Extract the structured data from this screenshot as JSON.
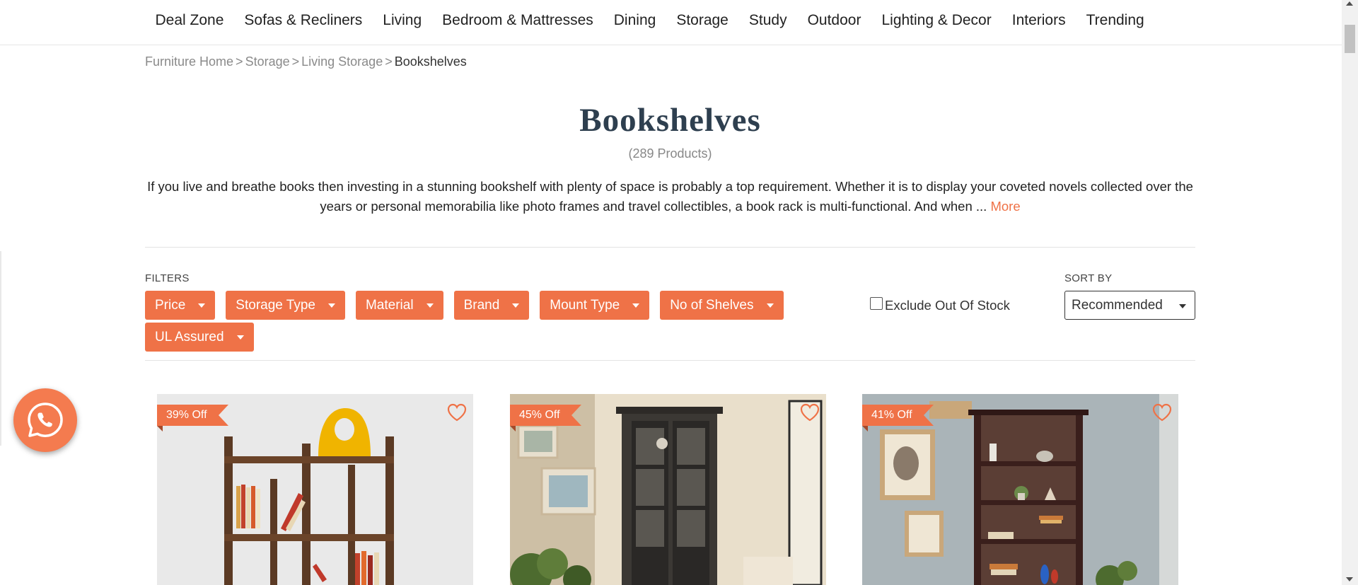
{
  "nav": {
    "items": [
      {
        "label": "Deal Zone"
      },
      {
        "label": "Sofas & Recliners"
      },
      {
        "label": "Living"
      },
      {
        "label": "Bedroom & Mattresses"
      },
      {
        "label": "Dining"
      },
      {
        "label": "Storage"
      },
      {
        "label": "Study"
      },
      {
        "label": "Outdoor"
      },
      {
        "label": "Lighting & Decor"
      },
      {
        "label": "Interiors"
      },
      {
        "label": "Trending"
      }
    ]
  },
  "breadcrumb": {
    "items": [
      "Furniture Home",
      "Storage",
      "Living Storage"
    ],
    "separator": ">",
    "current": "Bookshelves"
  },
  "page": {
    "title": "Bookshelves",
    "count": "(289 Products)",
    "description": "If you live and breathe books then investing in a stunning bookshelf with plenty of space is probably a top requirement. Whether it is to display your coveted novels collected over the years or personal memorabilia like photo frames and travel collectibles, a book rack is multi-functional. And when ... ",
    "more_label": "More"
  },
  "filters": {
    "label": "FILTERS",
    "items": [
      {
        "label": "Price"
      },
      {
        "label": "Storage Type"
      },
      {
        "label": "Material"
      },
      {
        "label": "Brand"
      },
      {
        "label": "Mount Type"
      },
      {
        "label": "No of Shelves"
      },
      {
        "label": "UL Assured"
      }
    ],
    "exclude_label": "Exclude Out Of Stock",
    "exclude_checked": false
  },
  "sort": {
    "label": "SORT BY",
    "selected": "Recommended"
  },
  "products": [
    {
      "discount": "39% Off",
      "icon": "heart-icon"
    },
    {
      "discount": "45% Off",
      "icon": "heart-icon"
    },
    {
      "discount": "41% Off",
      "icon": "heart-icon"
    }
  ],
  "colors": {
    "accent": "#ef7247",
    "title": "#2e3f4f",
    "whatsapp": "#f47b4f"
  },
  "floating": {
    "icon": "whatsapp-icon"
  }
}
